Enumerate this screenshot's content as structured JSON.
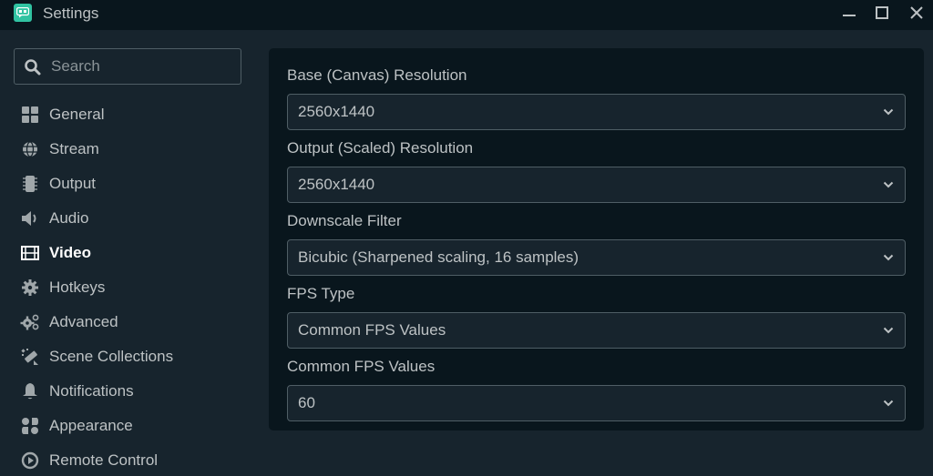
{
  "window": {
    "title": "Settings",
    "controls": {
      "minimize": "minimize",
      "maximize": "maximize",
      "close": "close"
    }
  },
  "sidebar": {
    "search": {
      "placeholder": "Search",
      "value": ""
    },
    "items": [
      {
        "label": "General",
        "icon": "grid-icon",
        "active": false
      },
      {
        "label": "Stream",
        "icon": "globe-icon",
        "active": false
      },
      {
        "label": "Output",
        "icon": "chip-icon",
        "active": false
      },
      {
        "label": "Audio",
        "icon": "speaker-icon",
        "active": false
      },
      {
        "label": "Video",
        "icon": "film-icon",
        "active": true
      },
      {
        "label": "Hotkeys",
        "icon": "gear-icon",
        "active": false
      },
      {
        "label": "Advanced",
        "icon": "gears-icon",
        "active": false
      },
      {
        "label": "Scene Collections",
        "icon": "magic-wand-icon",
        "active": false
      },
      {
        "label": "Notifications",
        "icon": "bell-icon",
        "active": false
      },
      {
        "label": "Appearance",
        "icon": "shapes-icon",
        "active": false
      },
      {
        "label": "Remote Control",
        "icon": "play-circle-icon",
        "active": false
      }
    ]
  },
  "main": {
    "fields": [
      {
        "label": "Base (Canvas) Resolution",
        "value": "2560x1440"
      },
      {
        "label": "Output (Scaled) Resolution",
        "value": "2560x1440"
      },
      {
        "label": "Downscale Filter",
        "value": "Bicubic (Sharpened scaling, 16 samples)"
      },
      {
        "label": "FPS Type",
        "value": "Common FPS Values"
      },
      {
        "label": "Common FPS Values",
        "value": "60"
      }
    ]
  },
  "colors": {
    "accent": "#31c3a2",
    "titlebar_bg": "#09161d",
    "sidebar_bg": "#17242d",
    "panel_bg": "#09161d",
    "input_bg": "#17242d",
    "border": "#4f5e65",
    "text": "#bdc2c4",
    "active_text": "#ffffff"
  }
}
